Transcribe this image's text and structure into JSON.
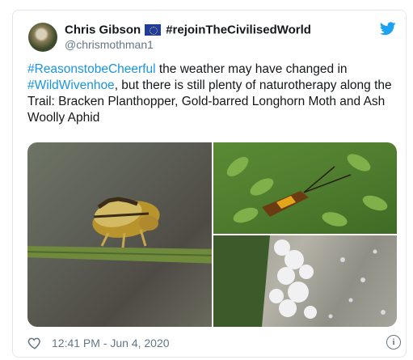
{
  "tweet": {
    "author_name": "Chris Gibson",
    "author_flag_icon": "eu-flag-icon",
    "author_hashtag": "#rejoinTheCivilisedWorld",
    "handle": "@chrismothman1",
    "body": {
      "tag1": "#ReasonstobeCheerful",
      "text1": " the weather may have changed in ",
      "tag2": "#WildWivenhoe",
      "text2": ", but there is still plenty of naturotherapy along the Trail: Bracken Planthopper, Gold-barred Longhorn Moth and Ash Woolly Aphid"
    },
    "timestamp": "12:41 PM - Jun 4, 2020",
    "link_color": "#1b95e0",
    "twitter_blue": "#1da1f2"
  }
}
